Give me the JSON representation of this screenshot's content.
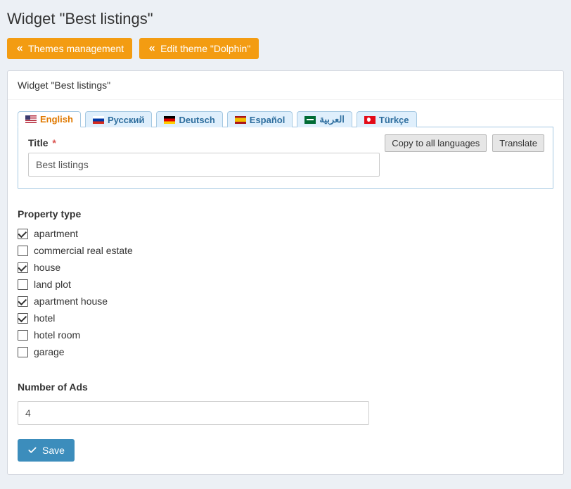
{
  "page_title": "Widget \"Best listings\"",
  "top_buttons": {
    "themes_management": "Themes management",
    "edit_theme": "Edit theme \"Dolphin\""
  },
  "panel": {
    "header": "Widget \"Best listings\""
  },
  "tabs": [
    {
      "label": "English",
      "flag": "us",
      "active": true
    },
    {
      "label": "Русский",
      "flag": "ru",
      "active": false
    },
    {
      "label": "Deutsch",
      "flag": "de",
      "active": false
    },
    {
      "label": "Español",
      "flag": "es",
      "active": false
    },
    {
      "label": "العربية",
      "flag": "ar",
      "active": false
    },
    {
      "label": "Türkçe",
      "flag": "tr",
      "active": false
    }
  ],
  "tab_actions": {
    "copy_all": "Copy to all languages",
    "translate": "Translate"
  },
  "title_field": {
    "label": "Title",
    "required_mark": "*",
    "value": "Best listings"
  },
  "property_type": {
    "label": "Property type",
    "items": [
      {
        "label": "apartment",
        "checked": true
      },
      {
        "label": "commercial real estate",
        "checked": false
      },
      {
        "label": "house",
        "checked": true
      },
      {
        "label": "land plot",
        "checked": false
      },
      {
        "label": "apartment house",
        "checked": true
      },
      {
        "label": "hotel",
        "checked": true
      },
      {
        "label": "hotel room",
        "checked": false
      },
      {
        "label": "garage",
        "checked": false
      }
    ]
  },
  "number_of_ads": {
    "label": "Number of Ads",
    "value": "4"
  },
  "save_button": "Save"
}
